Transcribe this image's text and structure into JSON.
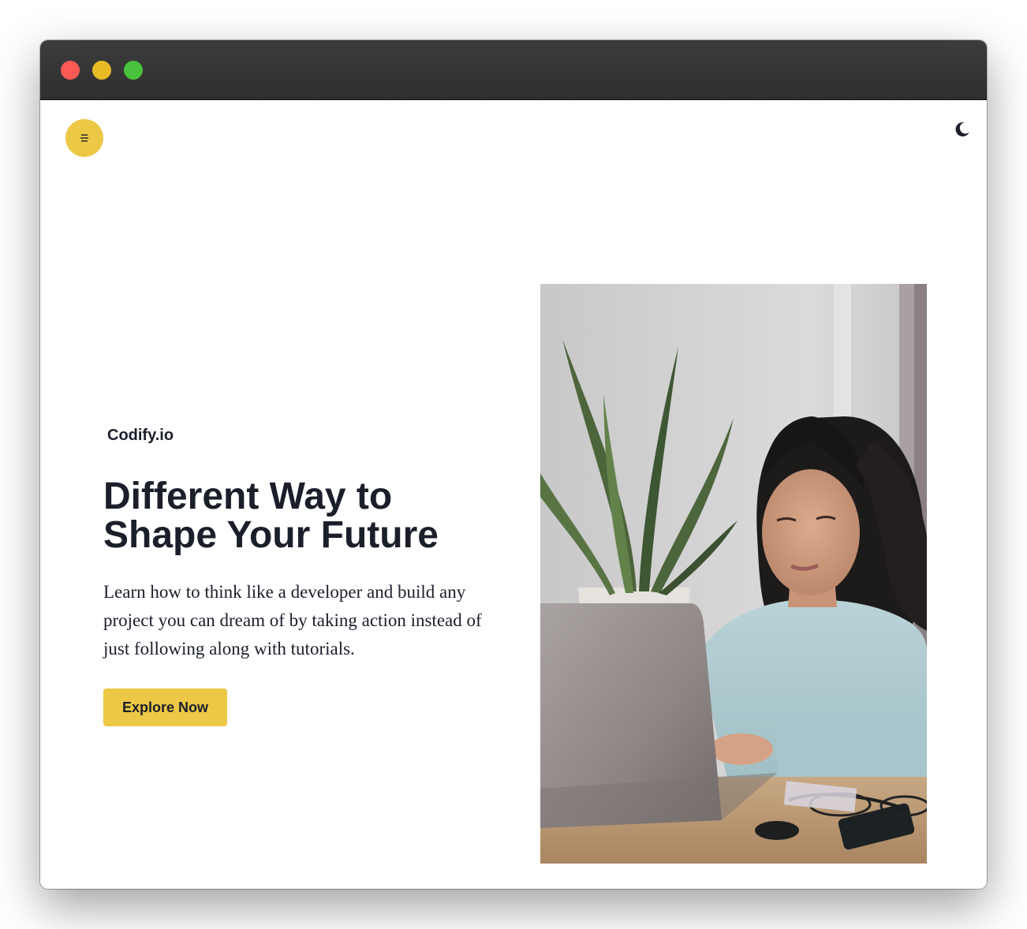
{
  "window": {
    "controls": [
      "close",
      "minimize",
      "maximize"
    ],
    "colors": {
      "close": "#fd5a55",
      "minimize": "#e7bb26",
      "maximize": "#48c23d"
    }
  },
  "nav": {
    "menu_icon": "menu-icon",
    "theme_icon": "moon-icon"
  },
  "hero": {
    "brand": "Codify.io",
    "headline_line1": "Different Way to",
    "headline_line2": "Shape Your Future",
    "description": "Learn how to think like a developer and build any project you can dream of by taking action instead of just following along with tutorials.",
    "cta_label": "Explore Now",
    "image_alt": "Woman in a light blue sweater working on a laptop next to a potted plant"
  },
  "colors": {
    "accent": "#ecc846",
    "text": "#1b1f2a",
    "titlebar": "#333333"
  }
}
